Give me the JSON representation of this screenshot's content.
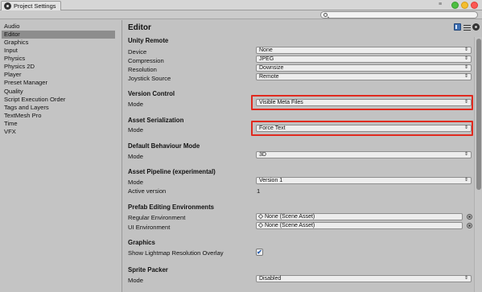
{
  "window": {
    "tab_title": "Project Settings",
    "search": {
      "placeholder": "",
      "value": ""
    }
  },
  "sidebar": {
    "items": [
      {
        "label": "Audio",
        "selected": false
      },
      {
        "label": "Editor",
        "selected": true
      },
      {
        "label": "Graphics",
        "selected": false
      },
      {
        "label": "Input",
        "selected": false
      },
      {
        "label": "Physics",
        "selected": false
      },
      {
        "label": "Physics 2D",
        "selected": false
      },
      {
        "label": "Player",
        "selected": false
      },
      {
        "label": "Preset Manager",
        "selected": false
      },
      {
        "label": "Quality",
        "selected": false
      },
      {
        "label": "Script Execution Order",
        "selected": false
      },
      {
        "label": "Tags and Layers",
        "selected": false
      },
      {
        "label": "TextMesh Pro",
        "selected": false
      },
      {
        "label": "Time",
        "selected": false
      },
      {
        "label": "VFX",
        "selected": false
      }
    ]
  },
  "main": {
    "title": "Editor",
    "unity_remote": {
      "header": "Unity Remote",
      "device_label": "Device",
      "device_value": "None",
      "compression_label": "Compression",
      "compression_value": "JPEG",
      "resolution_label": "Resolution",
      "resolution_value": "Downsize",
      "joystick_label": "Joystick Source",
      "joystick_value": "Remote"
    },
    "version_control": {
      "header": "Version Control",
      "mode_label": "Mode",
      "mode_value": "Visible Meta Files"
    },
    "asset_serialization": {
      "header": "Asset Serialization",
      "mode_label": "Mode",
      "mode_value": "Force Text"
    },
    "default_behaviour": {
      "header": "Default Behaviour Mode",
      "mode_label": "Mode",
      "mode_value": "3D"
    },
    "asset_pipeline": {
      "header": "Asset Pipeline (experimental)",
      "mode_label": "Mode",
      "mode_value": "Version 1",
      "active_label": "Active version",
      "active_value": "1"
    },
    "prefab_editing": {
      "header": "Prefab Editing Environments",
      "regular_label": "Regular Environment",
      "regular_value": "None (Scene Asset)",
      "ui_label": "UI Environment",
      "ui_value": "None (Scene Asset)"
    },
    "graphics": {
      "header": "Graphics",
      "lightmap_label": "Show Lightmap Resolution Overlay",
      "lightmap_checked": true,
      "check_glyph": "✔"
    },
    "sprite_packer": {
      "header": "Sprite Packer",
      "mode_label": "Mode",
      "mode_value": "Disabled"
    }
  },
  "glyphs": {
    "dropdown_arrow": "⇕",
    "window_menu": "≡"
  },
  "colors": {
    "highlight_box": "#e02a1f",
    "selected_item": "#8d8d8d",
    "checkbox_check": "#2a5fb0"
  }
}
